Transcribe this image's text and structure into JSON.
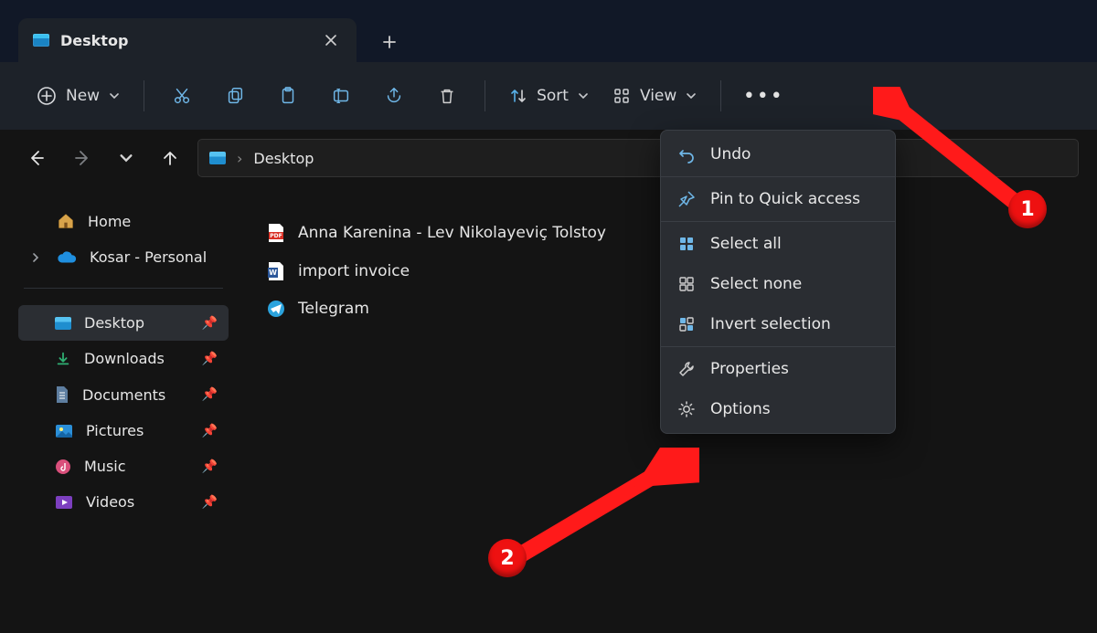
{
  "tab": {
    "title": "Desktop"
  },
  "toolbar": {
    "new": "New",
    "sort": "Sort",
    "view": "View"
  },
  "breadcrumb": {
    "current": "Desktop"
  },
  "sidebar": {
    "home": "Home",
    "cloud": "Kosar - Personal",
    "pinned": [
      {
        "label": "Desktop"
      },
      {
        "label": "Downloads"
      },
      {
        "label": "Documents"
      },
      {
        "label": "Pictures"
      },
      {
        "label": "Music"
      },
      {
        "label": "Videos"
      }
    ]
  },
  "files": [
    {
      "name": "Anna Karenina - Lev Nikolayeviç Tolstoy",
      "icon": "pdf"
    },
    {
      "name": "import invoice",
      "icon": "word"
    },
    {
      "name": "Telegram",
      "icon": "telegram"
    }
  ],
  "menu": {
    "undo": "Undo",
    "pin": "Pin to Quick access",
    "select_all": "Select all",
    "select_none": "Select none",
    "invert": "Invert selection",
    "properties": "Properties",
    "options": "Options"
  },
  "annotations": {
    "one": "1",
    "two": "2"
  }
}
